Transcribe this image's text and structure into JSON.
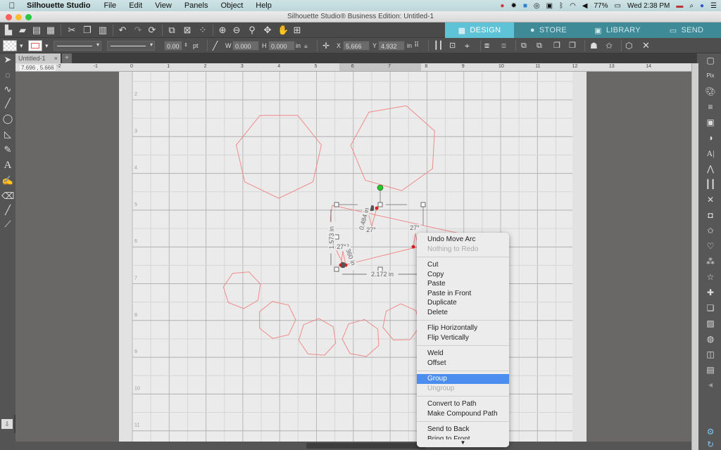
{
  "menubar": {
    "apple": "",
    "app_name": "Silhouette Studio",
    "items": [
      "File",
      "Edit",
      "View",
      "Panels",
      "Object",
      "Help"
    ],
    "battery": "77%",
    "clock": "Wed 2:38 PM"
  },
  "window": {
    "title": "Silhouette Studio® Business Edition: Untitled-1"
  },
  "nav_tabs": [
    {
      "label": "DESIGN",
      "icon": "grid-icon",
      "active": true
    },
    {
      "label": "STORE",
      "icon": "store-s-icon",
      "active": false
    },
    {
      "label": "LIBRARY",
      "icon": "library-folder-icon",
      "active": false
    },
    {
      "label": "SEND",
      "icon": "cutter-icon",
      "active": false
    }
  ],
  "toolbar2": {
    "line_width": "0.00",
    "line_unit": "pt",
    "w_label": "W",
    "w_value": "0.000",
    "h_label": "H",
    "h_value": "0.000",
    "size_unit": "in",
    "x_label": "X",
    "x_value": "5.666",
    "y_label": "Y",
    "y_value": "4.932",
    "pos_unit": "in"
  },
  "document_tab": {
    "label": "Untitled-1",
    "close": "×",
    "add": "+"
  },
  "cursor_coords": "7.696 , 5.666",
  "ruler_top": [
    "-2",
    "-1",
    "0",
    "1",
    "2",
    "3",
    "4",
    "5",
    "6",
    "7",
    "8",
    "9",
    "10",
    "11",
    "12",
    "13",
    "14"
  ],
  "ruler_left": [
    "2",
    "3",
    "4",
    "5",
    "6",
    "7",
    "8",
    "9",
    "10",
    "11"
  ],
  "measurements": {
    "width": "2.172 in",
    "height": "1.573 in",
    "seg1": "0.484 in",
    "seg2": "0.360 in",
    "angle1": "27°",
    "angle2": "27°",
    "angle3": "27°"
  },
  "context_menu": {
    "groups": [
      [
        {
          "label": "Undo Move Arc",
          "enabled": true
        },
        {
          "label": "Nothing to Redo",
          "enabled": false
        }
      ],
      [
        {
          "label": "Cut",
          "enabled": true
        },
        {
          "label": "Copy",
          "enabled": true
        },
        {
          "label": "Paste",
          "enabled": true
        },
        {
          "label": "Paste in Front",
          "enabled": true
        },
        {
          "label": "Duplicate",
          "enabled": true
        },
        {
          "label": "Delete",
          "enabled": true
        }
      ],
      [
        {
          "label": "Flip Horizontally",
          "enabled": true
        },
        {
          "label": "Flip Vertically",
          "enabled": true
        }
      ],
      [
        {
          "label": "Weld",
          "enabled": true
        },
        {
          "label": "Offset",
          "enabled": true
        }
      ],
      [
        {
          "label": "Group",
          "enabled": true,
          "highlighted": true
        },
        {
          "label": "Ungroup",
          "enabled": false
        }
      ],
      [
        {
          "label": "Convert to Path",
          "enabled": true
        },
        {
          "label": "Make Compound Path",
          "enabled": true
        }
      ],
      [
        {
          "label": "Send to Back",
          "enabled": true
        },
        {
          "label": "Bring to Front",
          "enabled": true
        }
      ]
    ],
    "more_arrow": "▼"
  },
  "colors": {
    "shape_stroke": "#f08a8a",
    "accent": "#5fc3d8",
    "nav_bg": "#3e8a96",
    "menu_highlight": "#4b8ef0",
    "rotate_handle": "#22cc22",
    "node": "#dd2222"
  }
}
